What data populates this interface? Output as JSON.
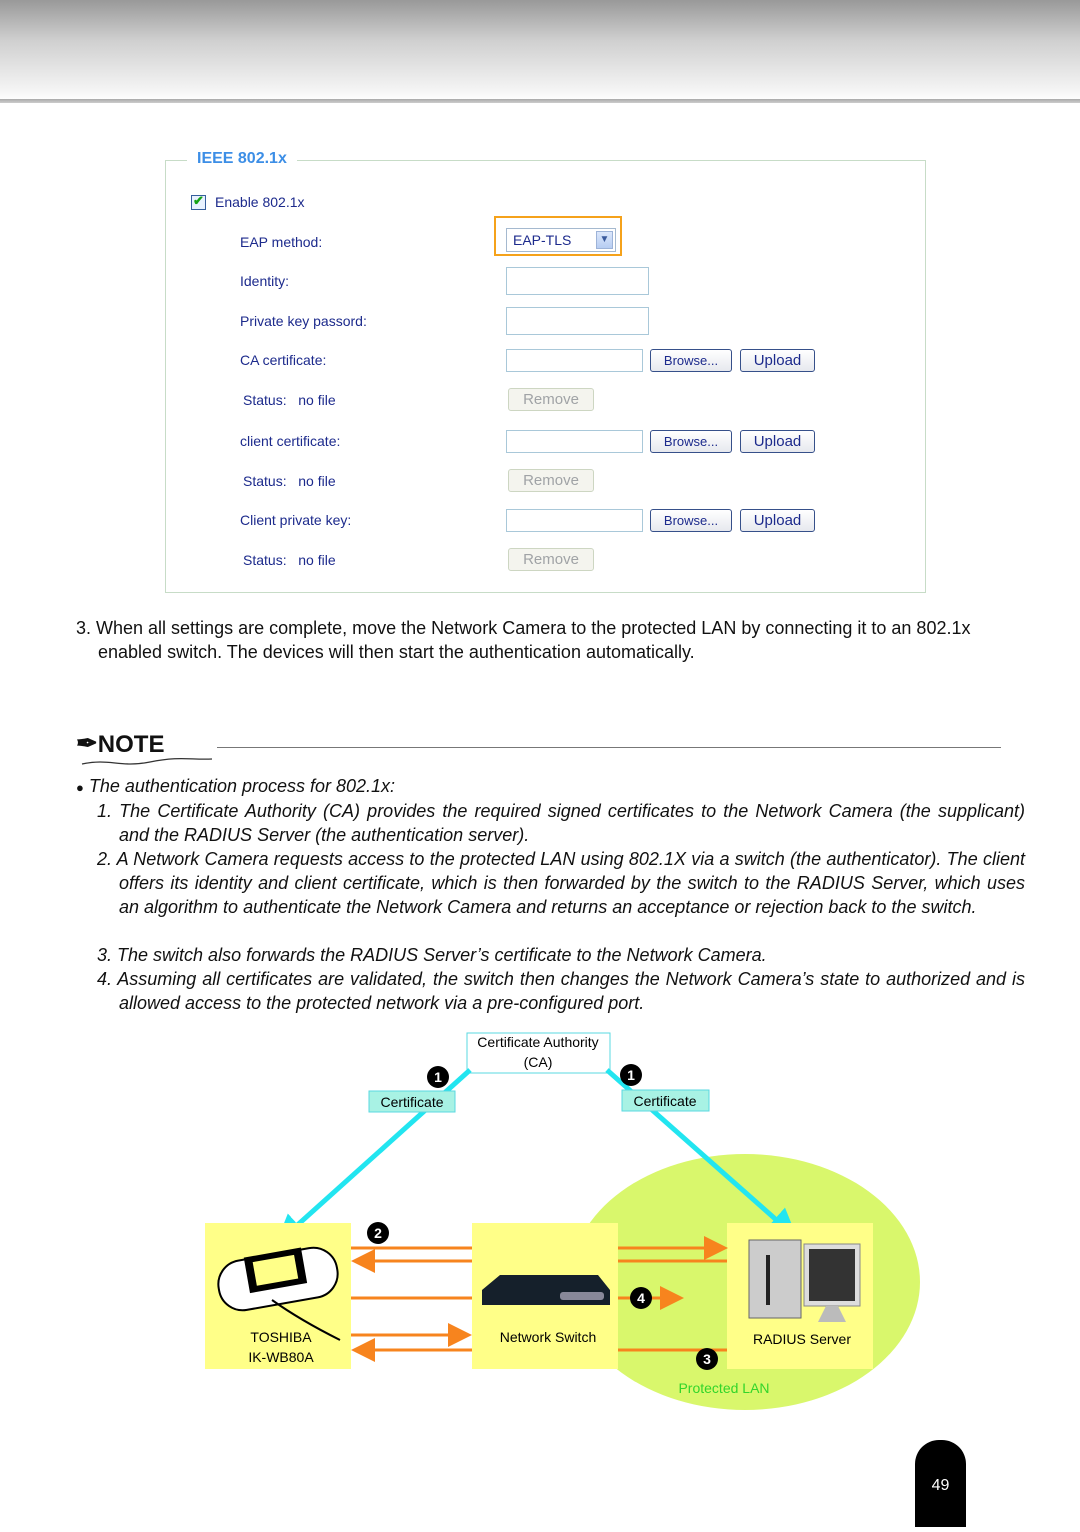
{
  "form": {
    "legend": "IEEE 802.1x",
    "enable_label": "Enable 802.1x",
    "enable_checked": true,
    "eap_label": "EAP method:",
    "eap_value": "EAP-TLS",
    "identity_label": "Identity:",
    "private_key_label": "Private key passord:",
    "ca_label": "CA certificate:",
    "client_cert_label": "client certificate:",
    "client_key_label": "Client private key:",
    "status_label": "Status:",
    "status_value": "no file",
    "browse": "Browse...",
    "upload": "Upload",
    "remove": "Remove"
  },
  "step3": "3. When all settings are complete, move the Network Camera to the protected LAN by connecting it to an 802.1x enabled switch. The devices will then start the authentication automatically.",
  "note": {
    "title": "NOTE",
    "bullet": "The authentication process for 802.1x:",
    "items": [
      {
        "num": "1.",
        "text": "The Certificate Authority (CA) provides the required signed certificates to the Network Camera (the supplicant) and the RADIUS Server (the authentication server)."
      },
      {
        "num": "2.",
        "text": "A Network Camera requests access to the protected LAN using 802.1X via a switch (the authenticator). The client offers its identity and client certificate, which is then forwarded by the switch to the RADIUS Server, which uses an algorithm to authenticate the Network Camera and returns an acceptance or rejection back to the switch."
      },
      {
        "num": "3.",
        "text": "The switch also forwards the RADIUS Server’s certificate to the Network Camera."
      },
      {
        "num": "4.",
        "text": "Assuming all certificates are validated, the switch then changes the Network Camera’s state to authorized and is allowed access to the protected network via a pre-configured port."
      }
    ]
  },
  "diagram": {
    "ca_line1": "Certificate Authority",
    "ca_line2": "(CA)",
    "certificate": "Certificate",
    "camera_line1": "TOSHIBA",
    "camera_line2": "IK-WB80A",
    "switch": "Network Switch",
    "radius": "RADIUS Server",
    "lan": "Protected LAN",
    "badges": [
      "1",
      "1",
      "2",
      "3",
      "4"
    ],
    "colors": {
      "arrow": "#f7841e",
      "cert_line": "#22e5f0",
      "lan": "#d9f76c",
      "box": "#ffff88",
      "cert_box": "#a8f2e4"
    }
  },
  "page_number": "49"
}
